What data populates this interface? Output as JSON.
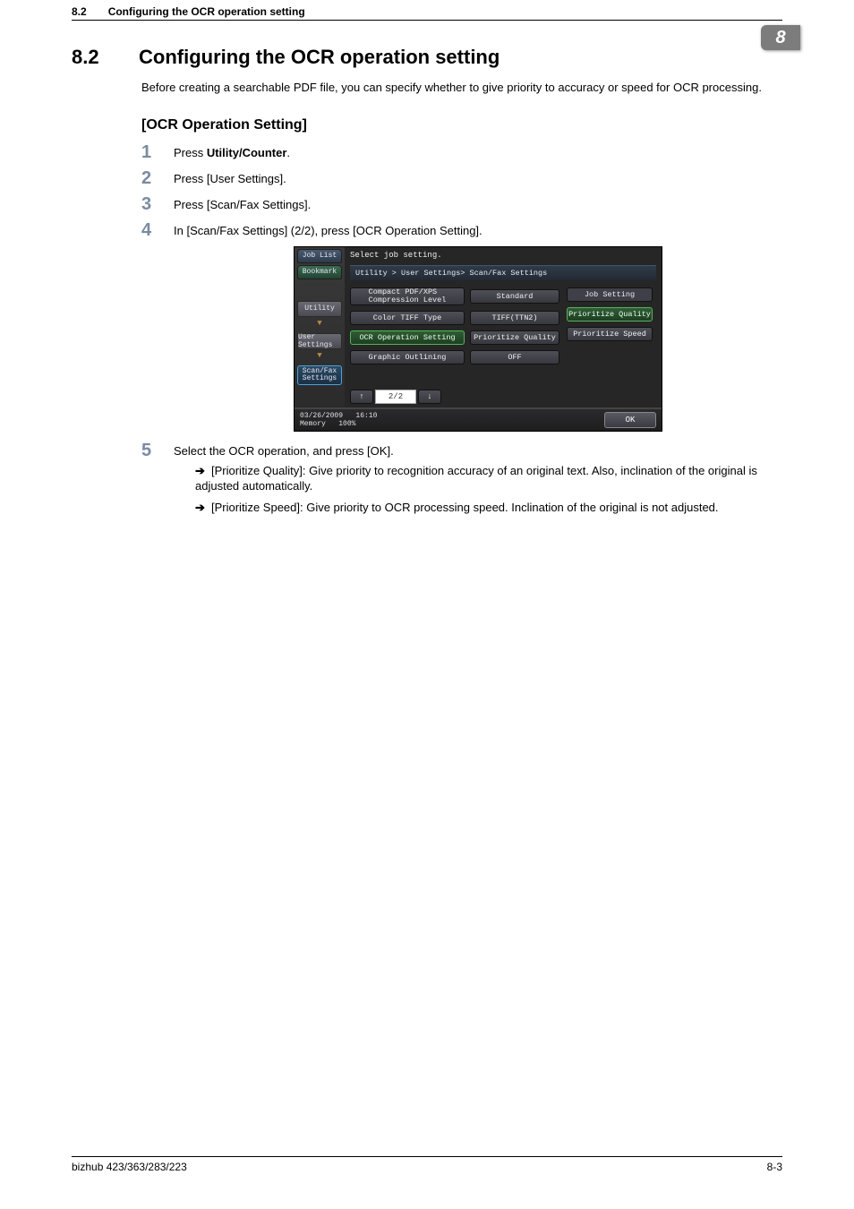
{
  "header": {
    "section_number": "8.2",
    "section_title": "Configuring the OCR operation setting",
    "chapter_tab": "8"
  },
  "section": {
    "number": "8.2",
    "title": "Configuring the OCR operation setting",
    "intro": "Before creating a searchable PDF file, you can specify whether to give priority to accuracy or speed for OCR processing."
  },
  "subheading": "[OCR Operation Setting]",
  "steps": [
    {
      "prefix": "Press ",
      "bold": "Utility/Counter",
      "suffix": "."
    },
    {
      "text": "Press [User Settings]."
    },
    {
      "text": "Press [Scan/Fax Settings]."
    },
    {
      "text": "In [Scan/Fax Settings] (2/2), press [OCR Operation Setting]."
    },
    {
      "text": "Select the OCR operation, and press [OK]."
    }
  ],
  "bullets": [
    "[Prioritize Quality]: Give priority to recognition accuracy of an original text. Also, inclination of the original is adjusted automatically.",
    "[Prioritize Speed]: Give priority to OCR processing speed. Inclination of the original is not adjusted."
  ],
  "panel": {
    "job_list": "Job List",
    "bookmark": "Bookmark",
    "crumbs": {
      "utility": "Utility",
      "user_settings": "User Settings",
      "scan_fax": "Scan/Fax\nSettings"
    },
    "instruction": "Select job setting.",
    "path": "Utility > User Settings> Scan/Fax Settings",
    "rows": [
      {
        "label": "Compact PDF/XPS\nCompression Level",
        "value": "Standard"
      },
      {
        "label": "Color TIFF Type",
        "value": "TIFF(TTN2)"
      },
      {
        "label": "OCR Operation Setting",
        "value": "Prioritize Quality",
        "selected": true
      },
      {
        "label": "Graphic Outlining",
        "value": "OFF"
      }
    ],
    "side": {
      "heading": "Job Setting",
      "options": [
        "Prioritize Quality",
        "Prioritize Speed"
      ]
    },
    "pager": {
      "current": "2/2",
      "up": "↑",
      "down": "↓"
    },
    "footer": {
      "date": "03/26/2009",
      "time": "16:10",
      "memory_label": "Memory",
      "memory_value": "100%",
      "ok": "OK"
    }
  },
  "arrow_glyph": "➔",
  "page_footer": {
    "left": "bizhub 423/363/283/223",
    "right": "8-3"
  }
}
